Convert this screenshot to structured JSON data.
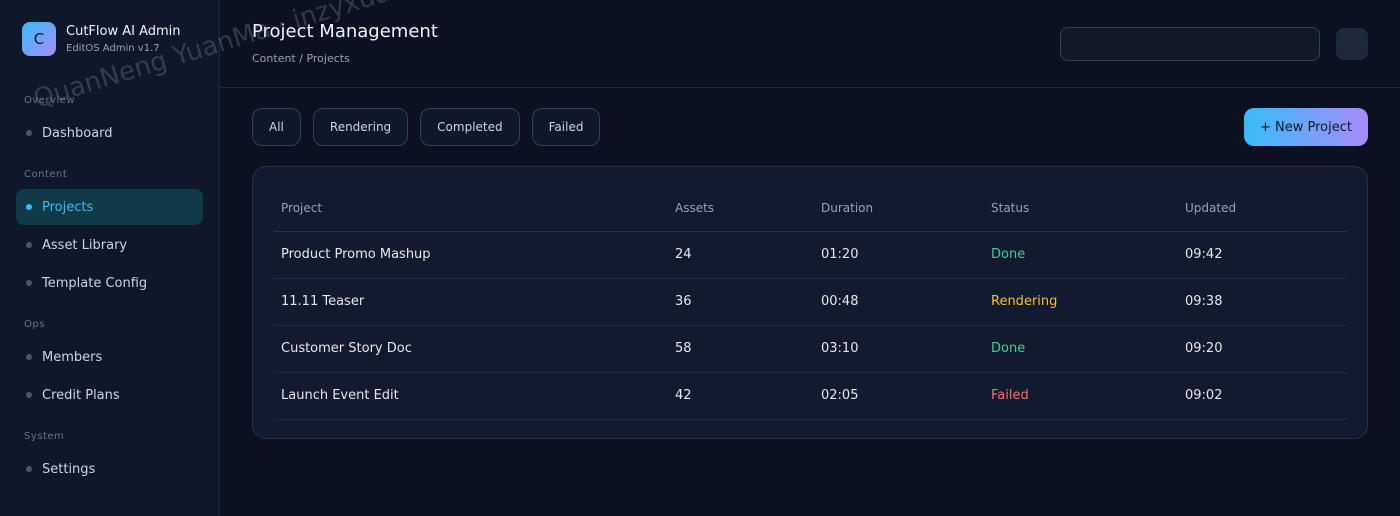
{
  "app": {
    "logo_letter": "C",
    "title": "CutFlow AI Admin",
    "subtitle": "EditOS Admin v1.7"
  },
  "sidebar": {
    "sections": [
      {
        "label": "Overview",
        "items": [
          {
            "label": "Dashboard",
            "active": false
          }
        ]
      },
      {
        "label": "Content",
        "items": [
          {
            "label": "Projects",
            "active": true
          },
          {
            "label": "Asset Library",
            "active": false
          },
          {
            "label": "Template Config",
            "active": false
          }
        ]
      },
      {
        "label": "Ops",
        "items": [
          {
            "label": "Members",
            "active": false
          },
          {
            "label": "Credit Plans",
            "active": false
          }
        ]
      },
      {
        "label": "System",
        "items": [
          {
            "label": "Settings",
            "active": false
          }
        ]
      }
    ]
  },
  "header": {
    "title": "Project Management",
    "breadcrumb": "Content / Projects"
  },
  "filters": [
    "All",
    "Rendering",
    "Completed",
    "Failed"
  ],
  "actions": {
    "new_project": "+ New Project"
  },
  "table": {
    "columns": [
      "Project",
      "Assets",
      "Duration",
      "Status",
      "Updated"
    ],
    "rows": [
      {
        "project": "Product Promo Mashup",
        "assets": "24",
        "duration": "01:20",
        "status": "Done",
        "updated": "09:42"
      },
      {
        "project": "11.11 Teaser",
        "assets": "36",
        "duration": "00:48",
        "status": "Rendering",
        "updated": "09:38"
      },
      {
        "project": "Customer Story Doc",
        "assets": "58",
        "duration": "03:10",
        "status": "Done",
        "updated": "09:20"
      },
      {
        "project": "Launch Event Edit",
        "assets": "42",
        "duration": "02:05",
        "status": "Failed",
        "updated": "09:02"
      }
    ]
  },
  "colors": {
    "accent": "#38bdf8",
    "done": "#34d399",
    "rendering": "#fbbf24",
    "failed": "#f87171"
  },
  "watermark": "QuanNeng YuanMa · inzyxuashop.com"
}
